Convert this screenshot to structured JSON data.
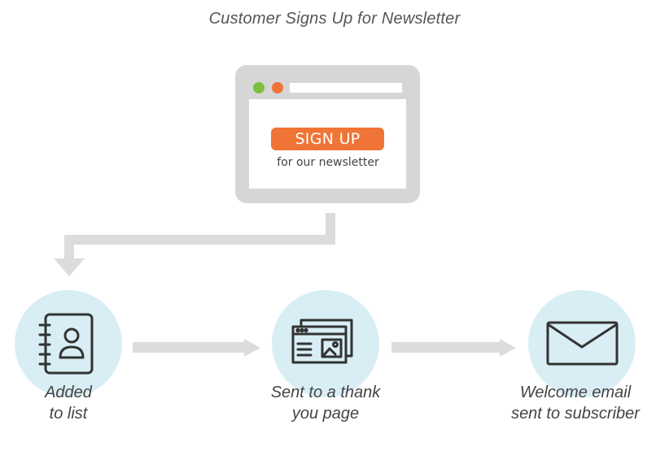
{
  "header": {
    "title": "Customer Signs Up for Newsletter"
  },
  "signup_card": {
    "button_label": "SIGN UP",
    "subtitle": "for our newsletter",
    "button_color": "#F07436",
    "dot_green": "#7CBF3F",
    "dot_orange": "#F07436"
  },
  "steps": [
    {
      "icon": "address-book-icon",
      "caption": "Added\nto list"
    },
    {
      "icon": "web-page-icon",
      "caption": "Sent to a thank\nyou page"
    },
    {
      "icon": "envelope-icon",
      "caption": "Welcome email\nsent to subscriber"
    }
  ],
  "colors": {
    "circle_fill": "#D8EEF4",
    "connector": "#DCDCDC",
    "icon_stroke": "#333333",
    "frame": "#D6D6D6"
  }
}
